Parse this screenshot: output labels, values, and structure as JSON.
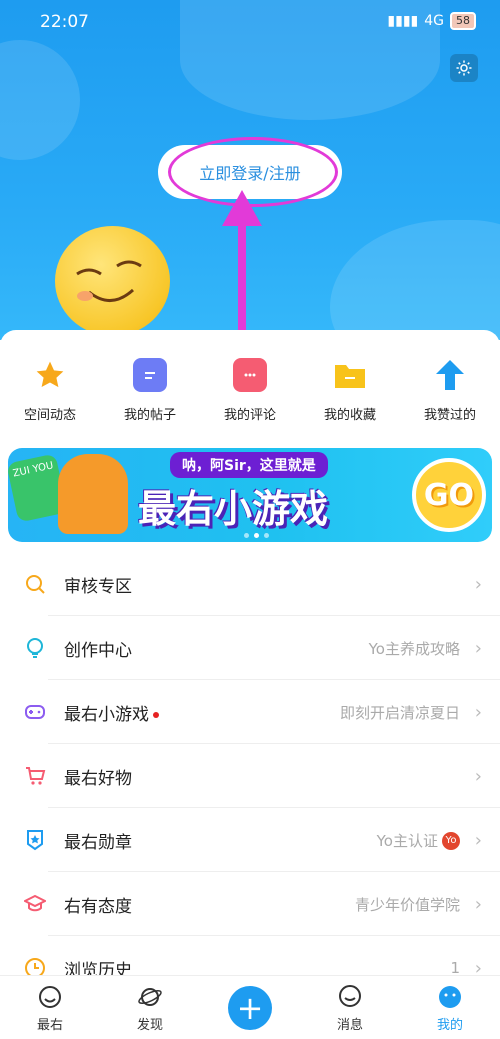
{
  "status_bar": {
    "time": "22:07",
    "network": "4G",
    "battery": "58"
  },
  "header": {
    "login_label": "立即登录/注册"
  },
  "shortcuts": [
    {
      "label": "空间动态",
      "icon": "star-icon",
      "color": "#f7a81b"
    },
    {
      "label": "我的帖子",
      "icon": "note-icon",
      "color": "#6d7cf5"
    },
    {
      "label": "我的评论",
      "icon": "comment-icon",
      "color": "#f55c72"
    },
    {
      "label": "我的收藏",
      "icon": "folder-icon",
      "color": "#f8c31a"
    },
    {
      "label": "我赞过的",
      "icon": "up-arrow-icon",
      "color": "#1e9cf0"
    }
  ],
  "banner": {
    "tag": "呐，阿Sir，这里就是",
    "title": "最右小游戏",
    "go": "GO",
    "badge": "ZUI YOU"
  },
  "menu": [
    {
      "label": "审核专区",
      "value": "",
      "icon": "search-icon",
      "color": "#f7a81b"
    },
    {
      "label": "创作中心",
      "value": "Yo主养成攻略",
      "icon": "lightbulb-icon",
      "color": "#1eb6d8"
    },
    {
      "label": "最右小游戏",
      "value": "即刻开启清凉夏日",
      "icon": "gamepad-icon",
      "color": "#8c5cf0",
      "dot": true
    },
    {
      "label": "最右好物",
      "value": "",
      "icon": "cart-icon",
      "color": "#f55c72"
    },
    {
      "label": "最右勋章",
      "value": "Yo主认证",
      "icon": "medal-icon",
      "color": "#1e9cf0",
      "badge": "Yo"
    },
    {
      "label": "右有态度",
      "value": "青少年价值学院",
      "icon": "graduation-cap-icon",
      "color": "#f55c72"
    },
    {
      "label": "浏览历史",
      "value": "1",
      "icon": "clock-icon",
      "color": "#f7a81b"
    }
  ],
  "tabbar": [
    {
      "label": "最右",
      "icon": "smile-icon"
    },
    {
      "label": "发现",
      "icon": "planet-icon"
    },
    {
      "label": "",
      "icon": "plus-icon"
    },
    {
      "label": "消息",
      "icon": "chat-icon"
    },
    {
      "label": "我的",
      "icon": "profile-icon"
    }
  ]
}
